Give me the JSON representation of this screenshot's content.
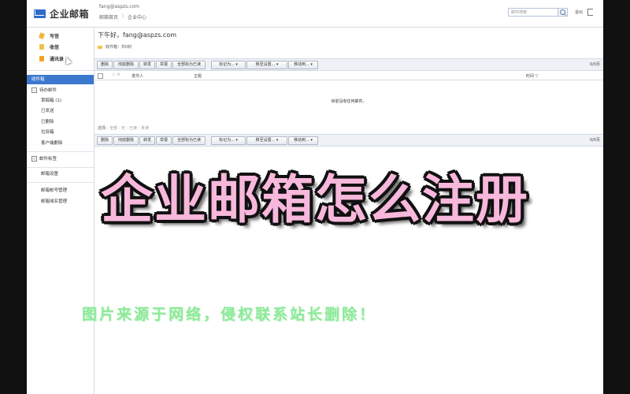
{
  "app": {
    "logo_text": "企业邮箱",
    "user_email": "fang@aspzs.com",
    "top_links": [
      "邮箱首页",
      "企业中心"
    ],
    "search_placeholder": "邮件搜索",
    "logout_label": "退出"
  },
  "sidebar": {
    "actions": [
      {
        "label": "写信",
        "icon": "pencil-icon"
      },
      {
        "label": "收信",
        "icon": "inbox-icon"
      },
      {
        "label": "通讯录",
        "icon": "contacts-icon"
      }
    ],
    "folders": [
      {
        "label": "收件箱",
        "active": true
      },
      {
        "label": "待办邮件"
      },
      {
        "label": "草稿箱  (1)"
      },
      {
        "label": "已发送"
      },
      {
        "label": "已删除"
      },
      {
        "label": "垃圾箱"
      },
      {
        "label": "客户端删除"
      }
    ],
    "tags_label": "邮件标签",
    "settings_label": "邮箱设置",
    "admin_items": [
      "邮箱帐号管理",
      "邮箱域名管理"
    ]
  },
  "main": {
    "greeting": "下午好，fang@aspzs.com",
    "mail_count": "收件箱：共0封",
    "toolbar_buttons": [
      "删除",
      "彻底删除",
      "转发",
      "举报",
      "全部标为已读"
    ],
    "toolbar_dropdowns": [
      "标记为... ▾",
      "移至设置... ▾",
      "移动到... ▾"
    ],
    "page_info": "0/0页",
    "list_headers": {
      "sender": "发件人",
      "subject": "主题",
      "time": "时间 ▽"
    },
    "empty_message": "目前没有任何邮件。",
    "select_label": "选择：",
    "select_options": "全部 - 无 - 已读 - 未读"
  },
  "overlay": {
    "title": "企业邮箱怎么注册",
    "watermark": "图片来源于网络，侵权联系站长删除！"
  },
  "colors": {
    "accent": "#3d78cf",
    "title_fill": "#f7b8db",
    "watermark": "#8ee99a"
  }
}
